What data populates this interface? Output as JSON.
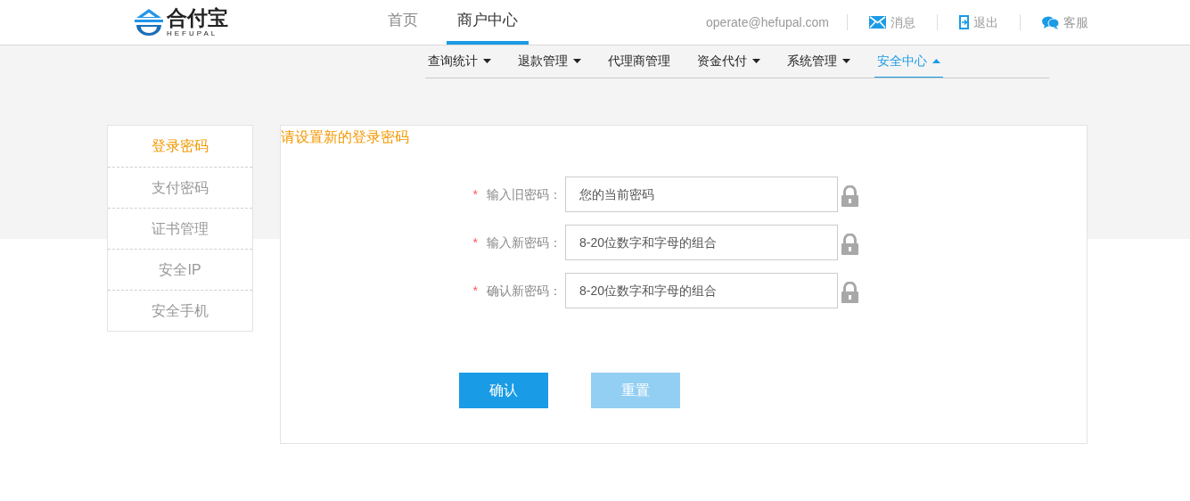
{
  "logo": {
    "name": "合付宝",
    "subtitle": "HEFUPAL"
  },
  "top_nav": [
    {
      "label": "首页",
      "selected": false
    },
    {
      "label": "商户中心",
      "selected": true
    }
  ],
  "user": {
    "email": "operate@hefupal.com"
  },
  "header_links": [
    {
      "kind": "messages",
      "label": "消息"
    },
    {
      "kind": "logout",
      "label": "退出"
    },
    {
      "kind": "support",
      "label": "客服"
    }
  ],
  "sub_nav": [
    {
      "label": "查询统计",
      "dropdown": true,
      "selected": false
    },
    {
      "label": "退款管理",
      "dropdown": true,
      "selected": false
    },
    {
      "label": "代理商管理",
      "dropdown": false,
      "selected": false
    },
    {
      "label": "资金代付",
      "dropdown": true,
      "selected": false
    },
    {
      "label": "系统管理",
      "dropdown": true,
      "selected": false
    },
    {
      "label": "安全中心",
      "dropdown": true,
      "selected": true
    }
  ],
  "sidebar": {
    "items": [
      {
        "label": "登录密码",
        "selected": true
      },
      {
        "label": "支付密码",
        "selected": false
      },
      {
        "label": "证书管理",
        "selected": false
      },
      {
        "label": "安全IP",
        "selected": false
      },
      {
        "label": "安全手机",
        "selected": false
      }
    ]
  },
  "form": {
    "title": "请设置新的登录密码",
    "fields": [
      {
        "required_mark": "*",
        "label": "输入旧密码：",
        "placeholder": "您的当前密码"
      },
      {
        "required_mark": "*",
        "label": "输入新密码：",
        "placeholder": "8-20位数字和字母的组合"
      },
      {
        "required_mark": "*",
        "label": "确认新密码：",
        "placeholder": "8-20位数字和字母的组合"
      }
    ],
    "buttons": [
      {
        "label": "确认",
        "kind": "primary"
      },
      {
        "label": "重置",
        "kind": "secondary"
      }
    ]
  }
}
